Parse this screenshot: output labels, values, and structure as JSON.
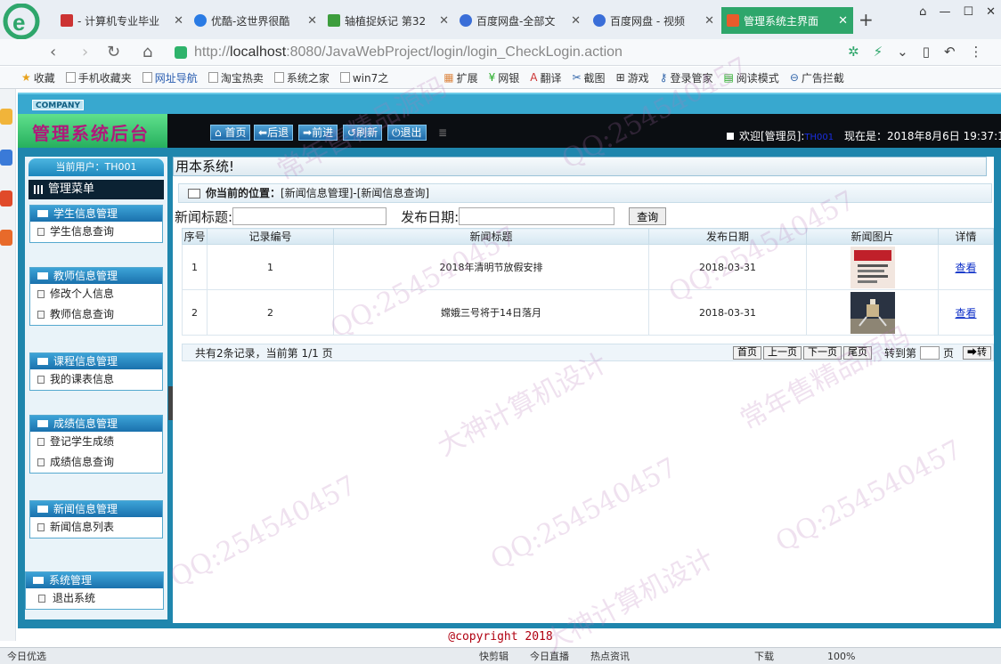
{
  "browser": {
    "tabs": [
      {
        "title": "- 计算机专业毕业",
        "fav": "#c33"
      },
      {
        "title": "优酷-这世界很酷",
        "fav": "#2a7be4"
      },
      {
        "title": "轴植捉妖记 第32",
        "fav": "#3d9d3d"
      },
      {
        "title": "百度网盘-全部文",
        "fav": "#3a6ed8"
      },
      {
        "title": "百度网盘 - 视频",
        "fav": "#3a6ed8"
      },
      {
        "title": "管理系统主界面",
        "fav": "#e85c2c"
      }
    ],
    "new_tab": "+",
    "url_scheme": "http://",
    "url_host": "localhost",
    "url_path": ":8080/JavaWebProject/login/login_CheckLogin.action",
    "bookmarks": [
      "收藏",
      "手机收藏夹",
      "网址导航",
      "淘宝热卖",
      "系统之家",
      "win7之",
      "扩展",
      "网银",
      "翻译",
      "截图",
      "游戏",
      "登录管家",
      "阅读模式",
      "广告拦截"
    ]
  },
  "app": {
    "company": "COMPANY",
    "title": "管理系统后台",
    "toolbar": {
      "home": "首页",
      "back": "后退",
      "forward": "前进",
      "refresh": "刷新",
      "logout": "退出"
    },
    "welcome_prefix": "欢迎[管理员]:",
    "welcome_user": "TH001",
    "now_label": "现在是：2018年8月6日 19:37:12"
  },
  "sidebar": {
    "current_user": "当前用户：TH001",
    "menu_title": "管理菜单",
    "groups": [
      {
        "title": "学生信息管理",
        "items": [
          "学生信息查询"
        ]
      },
      {
        "title": "教师信息管理",
        "items": [
          "修改个人信息",
          "教师信息查询"
        ]
      },
      {
        "title": "课程信息管理",
        "items": [
          "我的课表信息"
        ]
      },
      {
        "title": "成绩信息管理",
        "items": [
          "登记学生成绩",
          "成绩信息查询"
        ]
      },
      {
        "title": "新闻信息管理",
        "items": [
          "新闻信息列表"
        ]
      },
      {
        "title": "系统管理",
        "items": [
          "退出系统"
        ]
      }
    ]
  },
  "main": {
    "marquee": "用本系统!",
    "crumb_label": "你当前的位置：",
    "crumb_path": "[新闻信息管理]-[新闻信息查询]",
    "search": {
      "title_label": "新闻标题:",
      "title_value": "",
      "date_label": "发布日期:",
      "date_value": "",
      "button": "查询"
    },
    "columns": [
      "序号",
      "记录编号",
      "新闻标题",
      "发布日期",
      "新闻图片",
      "详情"
    ],
    "rows": [
      {
        "seq": "1",
        "id": "1",
        "title": "2018年清明节放假安排",
        "date": "2018-03-31",
        "detail": "查看"
      },
      {
        "seq": "2",
        "id": "2",
        "title": "嫦娥三号将于14日落月",
        "date": "2018-03-31",
        "detail": "查看"
      }
    ],
    "pager": {
      "summary": "共有2条记录，当前第 1/1 页",
      "first": "首页",
      "prev": "上一页",
      "next": "下一页",
      "last": "尾页",
      "goto_label": "转到第",
      "page_unit": "页",
      "go": "转"
    }
  },
  "footer": {
    "copyright": "@copyright 2018"
  },
  "statusbar": {
    "items": [
      "今日优选",
      "快剪辑",
      "今日直播",
      "热点资讯",
      "下载",
      "100%"
    ]
  },
  "watermark": [
    "常年售精品源码",
    "QQ:254540457",
    "大神计算机设计"
  ]
}
